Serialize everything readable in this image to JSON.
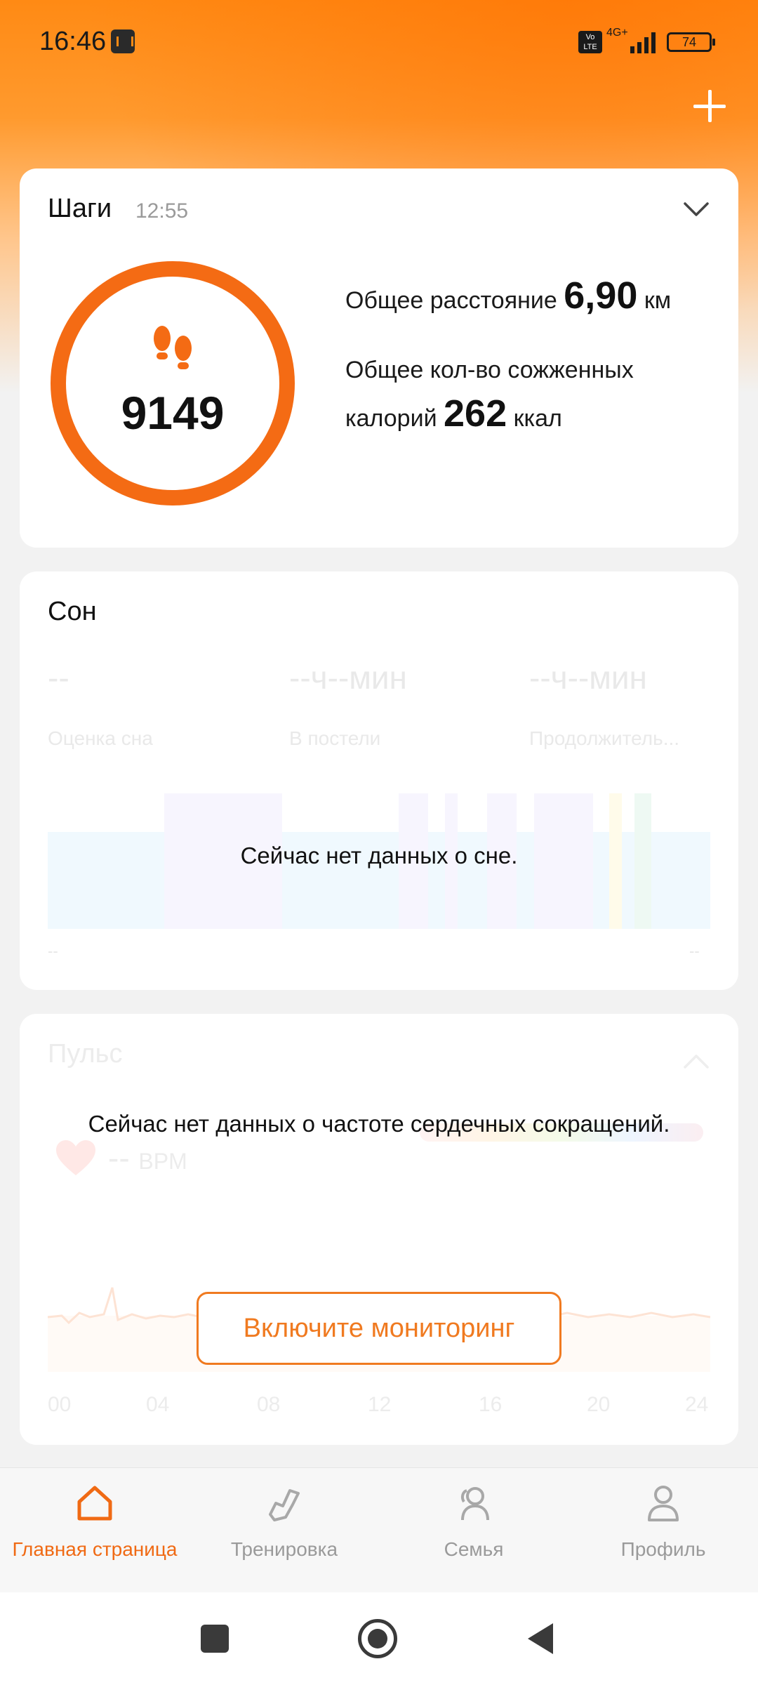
{
  "status_bar": {
    "time": "16:46",
    "network": "4G+",
    "volte": "Vo LTE",
    "battery": "74"
  },
  "colors": {
    "accent": "#f06a14",
    "header_gradient_top": "#ff8a14"
  },
  "steps": {
    "title": "Шаги",
    "time": "12:55",
    "count": "9149",
    "distance_label": "Общее расстояние",
    "distance_value": "6,90",
    "distance_unit": "км",
    "calories_label_line1": "Общее кол-во сожженных",
    "calories_label_line2": "калорий",
    "calories_value": "262",
    "calories_unit": "ккал"
  },
  "sleep": {
    "title": "Сон",
    "score_value": "--",
    "in_bed_value": "--ч--мин",
    "duration_value": "--ч--мин",
    "score_label": "Оценка сна",
    "in_bed_label": "В постели",
    "duration_label": "Продолжитель...",
    "no_data": "Сейчас нет данных о сне.",
    "axis_start": "--",
    "axis_end": "--"
  },
  "pulse": {
    "title": "Пульс",
    "no_data": "Сейчас нет данных о частоте сердечных сокращений.",
    "value": "--",
    "unit": "BPM",
    "enable_button": "Включите мониторинг",
    "axis_ticks": [
      "00",
      "04",
      "08",
      "12",
      "16",
      "20",
      "24"
    ]
  },
  "bottom_nav": {
    "items": [
      {
        "label": "Главная страница",
        "icon": "home-icon",
        "active": true
      },
      {
        "label": "Тренировка",
        "icon": "shoe-icon",
        "active": false
      },
      {
        "label": "Семья",
        "icon": "family-icon",
        "active": false
      },
      {
        "label": "Профиль",
        "icon": "profile-icon",
        "active": false
      }
    ]
  }
}
